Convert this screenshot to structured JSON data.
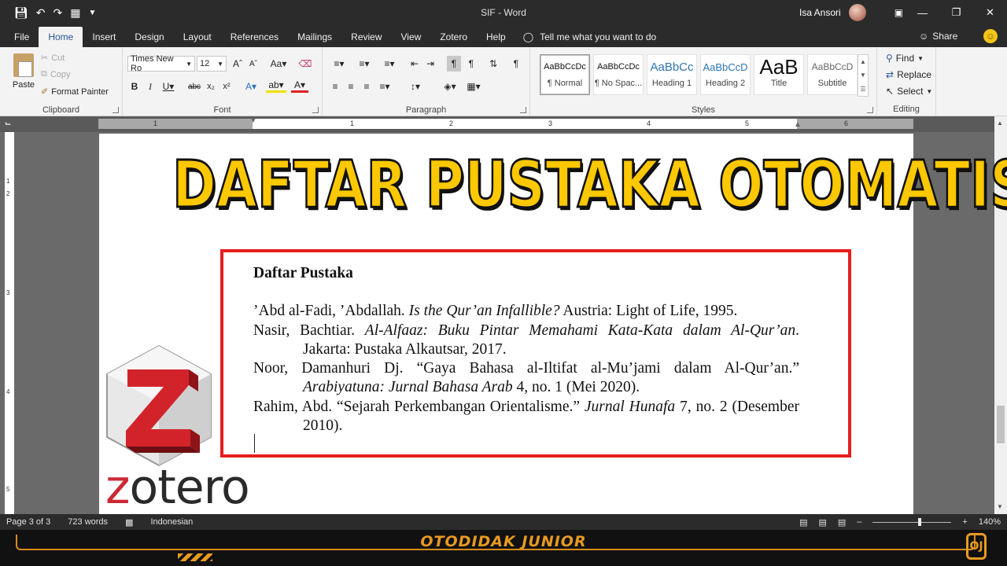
{
  "titlebar": {
    "doc_title": "SIF - Word",
    "user_name": "Isa Ansori"
  },
  "tabs": [
    "File",
    "Home",
    "Insert",
    "Design",
    "Layout",
    "References",
    "Mailings",
    "Review",
    "View",
    "Zotero",
    "Help"
  ],
  "tell_me": "Tell me what you want to do",
  "share": "Share",
  "clipboard": {
    "paste": "Paste",
    "cut": "Cut",
    "copy": "Copy",
    "format_painter": "Format Painter",
    "label": "Clipboard"
  },
  "font": {
    "name": "Times New Ro",
    "size": "12",
    "label": "Font"
  },
  "paragraph": {
    "label": "Paragraph"
  },
  "styles": {
    "label": "Styles",
    "items": [
      {
        "sample": "AaBbCcDc",
        "name": "¶ Normal"
      },
      {
        "sample": "AaBbCcDc",
        "name": "¶ No Spac..."
      },
      {
        "sample": "AaBbCc",
        "name": "Heading 1"
      },
      {
        "sample": "AaBbCcD",
        "name": "Heading 2"
      },
      {
        "sample": "AaB",
        "name": "Title"
      },
      {
        "sample": "AaBbCcD",
        "name": "Subtitle"
      }
    ]
  },
  "editing": {
    "find": "Find",
    "replace": "Replace",
    "select": "Select",
    "label": "Editing"
  },
  "ruler": {
    "h_numbers": [
      "1",
      "1",
      "2",
      "3",
      "4",
      "5",
      "6"
    ],
    "v_numbers": [
      "1",
      "2",
      "3",
      "4",
      "5"
    ]
  },
  "document": {
    "headline": "DAFTAR PUSTAKA OTOMATIS",
    "heading": "Daftar Pustaka",
    "entries": [
      {
        "pre": "’Abd al-Fadi, ’Abdallah. ",
        "ital": "Is the Qur’an Infallible?",
        "post": " Austria: Light of Life, 1995."
      },
      {
        "pre": "Nasir, Bachtiar. ",
        "ital": "Al-Alfaaz: Buku Pintar Memahami Kata-Kata dalam Al-Qur’an",
        "post": ". Jakarta: Pustaka Alkautsar, 2017."
      },
      {
        "pre": "Noor, Damanhuri Dj. “Gaya Bahasa al-Iltifat al-Mu’jami dalam Al-Qur’an.” ",
        "ital": "Arabiyatuna: Jurnal Bahasa Arab",
        "post": " 4, no. 1 (Mei 2020)."
      },
      {
        "pre": "Rahim, Abd. “Sejarah Perkembangan Orientalisme.” ",
        "ital": "Jurnal Hunafa",
        "post": " 7, no. 2 (Desember 2010)."
      }
    ],
    "logo_word": "otero",
    "logo_z": "z"
  },
  "statusbar": {
    "page": "Page 3 of 3",
    "words": "723 words",
    "language": "Indonesian",
    "zoom": "140%"
  },
  "brand": {
    "text": "OTODIDAK JUNIOR",
    "badge": "OJ"
  },
  "colors": {
    "headline": "#fdc800",
    "refbox_border": "#e61e1e",
    "word_blue": "#2b579a",
    "brand_orange": "#e79a20"
  }
}
